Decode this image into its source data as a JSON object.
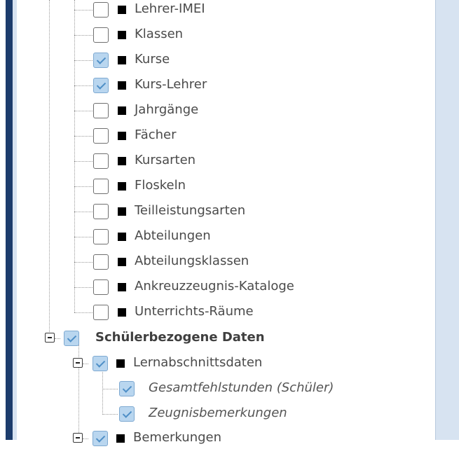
{
  "tree": {
    "items": [
      {
        "label": "Lehrer-IMEI",
        "checked": false
      },
      {
        "label": "Klassen",
        "checked": false
      },
      {
        "label": "Kurse",
        "checked": true
      },
      {
        "label": "Kurs-Lehrer",
        "checked": true
      },
      {
        "label": "Jahrgänge",
        "checked": false
      },
      {
        "label": "Fächer",
        "checked": false
      },
      {
        "label": "Kursarten",
        "checked": false
      },
      {
        "label": "Floskeln",
        "checked": false
      },
      {
        "label": "Teilleistungsarten",
        "checked": false
      },
      {
        "label": "Abteilungen",
        "checked": false
      },
      {
        "label": "Abteilungsklassen",
        "checked": false
      },
      {
        "label": "Ankreuzzeugnis-Kataloge",
        "checked": false
      },
      {
        "label": "Unterrichts-Räume",
        "checked": false
      }
    ],
    "group": {
      "label": "Schülerbezogene Daten",
      "checked": true
    },
    "subgroup": {
      "label": "Lernabschnittsdaten",
      "checked": true
    },
    "subitems": [
      {
        "label": "Gesamtfehlstunden (Schüler)",
        "checked": true
      },
      {
        "label": "Zeugnisbemerkungen",
        "checked": true
      }
    ],
    "next_group": {
      "label": "Bemerkungen",
      "checked": true
    }
  }
}
